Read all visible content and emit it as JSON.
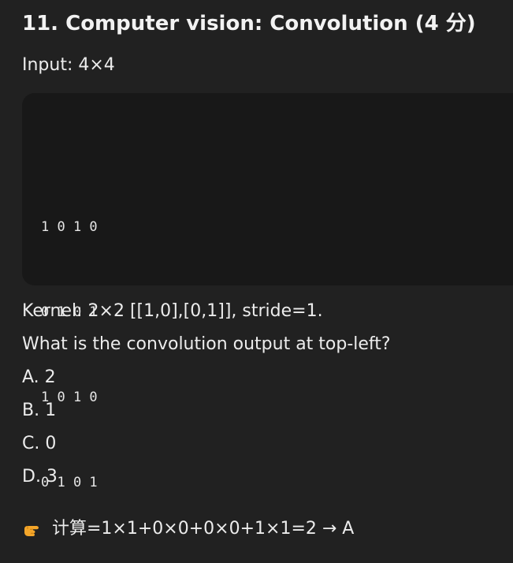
{
  "question": {
    "title": "11. Computer vision: Convolution (4 分)",
    "input_label": "Input: 4×4",
    "matrix_rows": [
      "1 0 1 0",
      "0 1 0 1",
      "1 0 1 0",
      "0 1 0 1"
    ],
    "kernel_text": "Kernel: 2×2 [[1,0],[0,1]], stride=1.",
    "prompt": "What is the convolution output at top-left?",
    "options": [
      "A. 2",
      "B. 1",
      "C. 0",
      "D. 3"
    ],
    "answer_text": "计算=1×1+0×0+0×0+1×1=2 → A",
    "answer_icon": "pointing-hand-icon"
  },
  "colors": {
    "background": "#212121",
    "code_background": "#181818",
    "text": "#ececec",
    "icon": "#f4a62a"
  }
}
